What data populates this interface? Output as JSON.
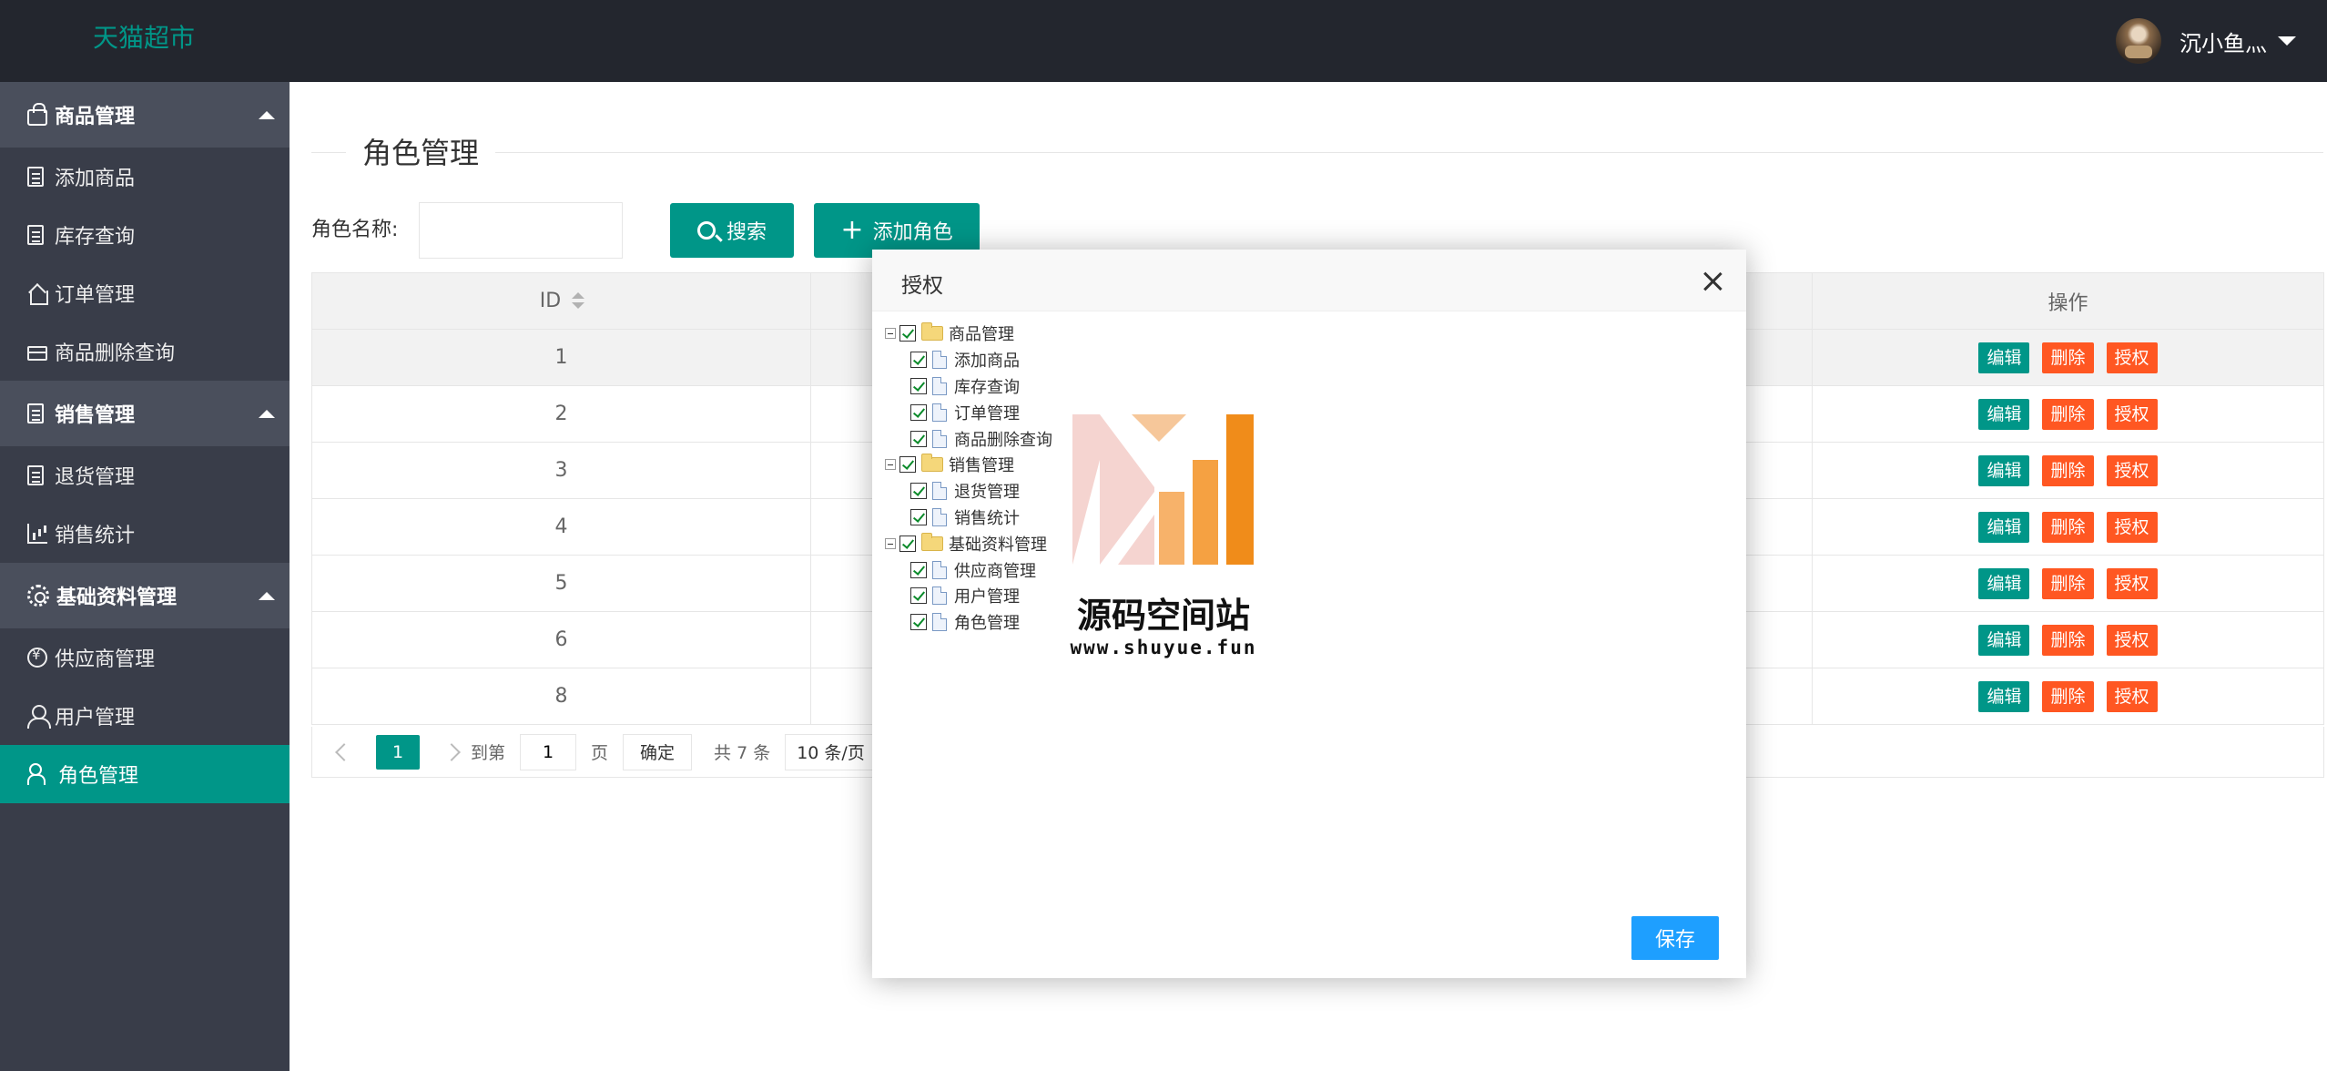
{
  "header": {
    "logo": "天猫超市",
    "user_name": "沉小鱼灬"
  },
  "sidebar": {
    "groups": [
      {
        "title": "商品管理",
        "icon": "bag-icon",
        "items": [
          {
            "label": "添加商品",
            "icon": "doc-icon"
          },
          {
            "label": "库存查询",
            "icon": "doc-icon"
          },
          {
            "label": "订单管理",
            "icon": "house-icon"
          },
          {
            "label": "商品删除查询",
            "icon": "card-icon"
          }
        ]
      },
      {
        "title": "销售管理",
        "icon": "clipboard-icon",
        "items": [
          {
            "label": "退货管理",
            "icon": "doc-icon"
          },
          {
            "label": "销售统计",
            "icon": "chart-icon"
          }
        ]
      },
      {
        "title": "基础资料管理",
        "icon": "gear-icon",
        "items": [
          {
            "label": "供应商管理",
            "icon": "yen-icon"
          },
          {
            "label": "用户管理",
            "icon": "user-icon"
          },
          {
            "label": "角色管理",
            "icon": "people-icon",
            "active": true
          }
        ]
      }
    ]
  },
  "page": {
    "title": "角色管理",
    "search_label": "角色名称:",
    "search_value": "",
    "search_button": "搜索",
    "add_button": "添加角色"
  },
  "table": {
    "columns": [
      "ID",
      "操作"
    ],
    "rows": [
      "1",
      "2",
      "3",
      "4",
      "5",
      "6",
      "8"
    ],
    "actions": {
      "edit": "编辑",
      "delete": "删除",
      "grant": "授权"
    }
  },
  "pager": {
    "current": "1",
    "goto_prefix": "到第",
    "goto_value": "1",
    "goto_suffix": "页",
    "confirm": "确定",
    "total": "共 7 条",
    "page_size": "10 条/页"
  },
  "modal": {
    "title": "授权",
    "save": "保存",
    "tree": [
      {
        "label": "商品管理",
        "checked": true,
        "children": [
          {
            "label": "添加商品",
            "checked": true
          },
          {
            "label": "库存查询",
            "checked": true
          },
          {
            "label": "订单管理",
            "checked": true
          },
          {
            "label": "商品删除查询",
            "checked": true
          }
        ]
      },
      {
        "label": "销售管理",
        "checked": true,
        "children": [
          {
            "label": "退货管理",
            "checked": true
          },
          {
            "label": "销售统计",
            "checked": true
          }
        ]
      },
      {
        "label": "基础资料管理",
        "checked": true,
        "children": [
          {
            "label": "供应商管理",
            "checked": true
          },
          {
            "label": "用户管理",
            "checked": true
          },
          {
            "label": "角色管理",
            "checked": true
          }
        ]
      }
    ]
  },
  "watermark": {
    "text": "源码空间站",
    "url": "www.shuyue.fun"
  },
  "colors": {
    "primary": "#009688",
    "danger": "#ff5722",
    "save": "#1e9fff",
    "header_bg": "#23262e",
    "sidebar_bg": "#393d49"
  }
}
